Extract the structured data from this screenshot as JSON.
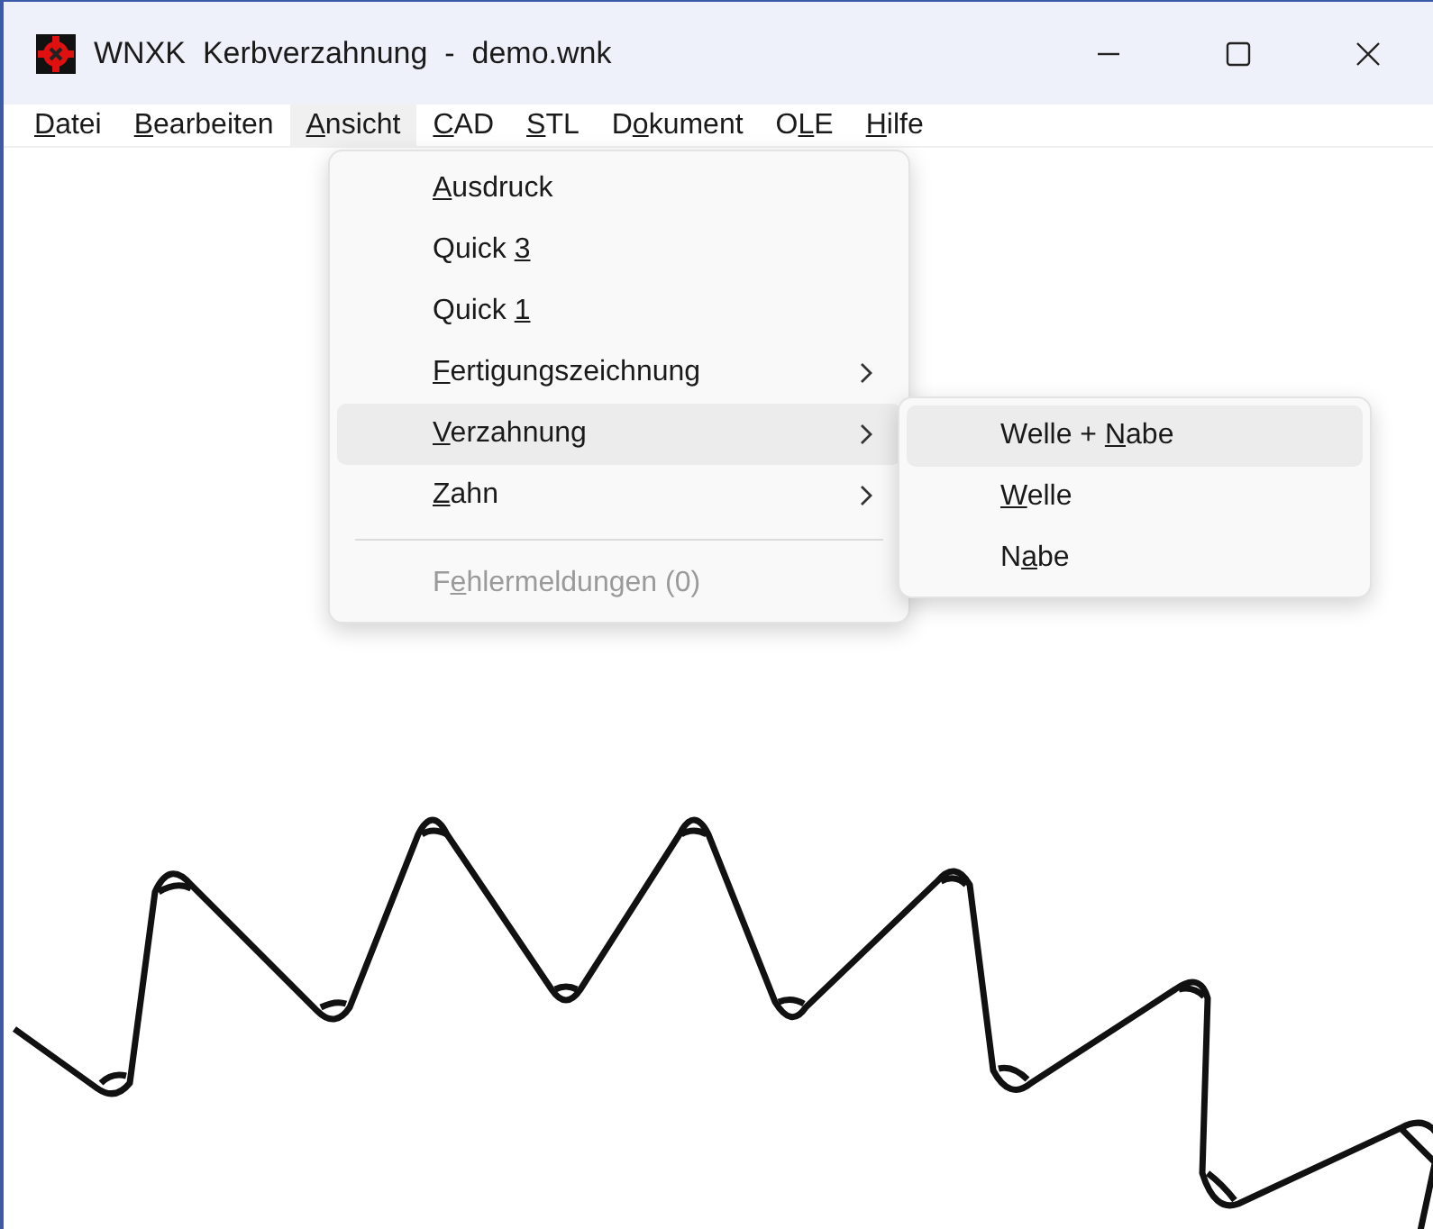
{
  "window": {
    "title": "WNXK  Kerbverzahnung  -  demo.wnk"
  },
  "menu_bar": [
    {
      "label": {
        "key": "D",
        "after": "atei"
      },
      "selected": false
    },
    {
      "label": {
        "key": "B",
        "after": "earbeiten"
      },
      "selected": false
    },
    {
      "label": {
        "key": "A",
        "after": "nsicht"
      },
      "selected": true
    },
    {
      "label": {
        "key": "C",
        "after": "AD"
      },
      "selected": false
    },
    {
      "label": {
        "key": "S",
        "after": "TL"
      },
      "selected": false
    },
    {
      "label": {
        "before": "D",
        "key": "o",
        "after": "kument"
      },
      "selected": false
    },
    {
      "label": {
        "before": "O",
        "key": "L",
        "after": "E"
      },
      "selected": false
    },
    {
      "label": {
        "key": "H",
        "after": "ilfe"
      },
      "selected": false
    }
  ],
  "dropdown": [
    {
      "kind": "item",
      "label": {
        "key": "A",
        "after": "usdruck"
      },
      "submenu": false,
      "selected": false,
      "disabled": false
    },
    {
      "kind": "item",
      "label": {
        "before": "Quick ",
        "key": "3"
      },
      "submenu": false,
      "selected": false,
      "disabled": false
    },
    {
      "kind": "item",
      "label": {
        "before": "Quick ",
        "key": "1"
      },
      "submenu": false,
      "selected": false,
      "disabled": false
    },
    {
      "kind": "item",
      "label": {
        "key": "F",
        "after": "ertigungszeichnung"
      },
      "submenu": true,
      "selected": false,
      "disabled": false
    },
    {
      "kind": "item",
      "label": {
        "key": "V",
        "after": "erzahnung"
      },
      "submenu": true,
      "selected": true,
      "disabled": false
    },
    {
      "kind": "item",
      "label": {
        "key": "Z",
        "after": "ahn"
      },
      "submenu": true,
      "selected": false,
      "disabled": false
    },
    {
      "kind": "separator"
    },
    {
      "kind": "item",
      "label": {
        "before": "F",
        "key": "e",
        "after": "hlermeldungen (0)"
      },
      "submenu": false,
      "selected": false,
      "disabled": true
    }
  ],
  "submenu": [
    {
      "label": {
        "before": "Welle + ",
        "key": "N",
        "after": "abe"
      },
      "selected": true
    },
    {
      "label": {
        "key": "W",
        "after": "elle"
      },
      "selected": false
    },
    {
      "label": {
        "before": "N",
        "key": "a",
        "after": "be"
      },
      "selected": false
    }
  ]
}
